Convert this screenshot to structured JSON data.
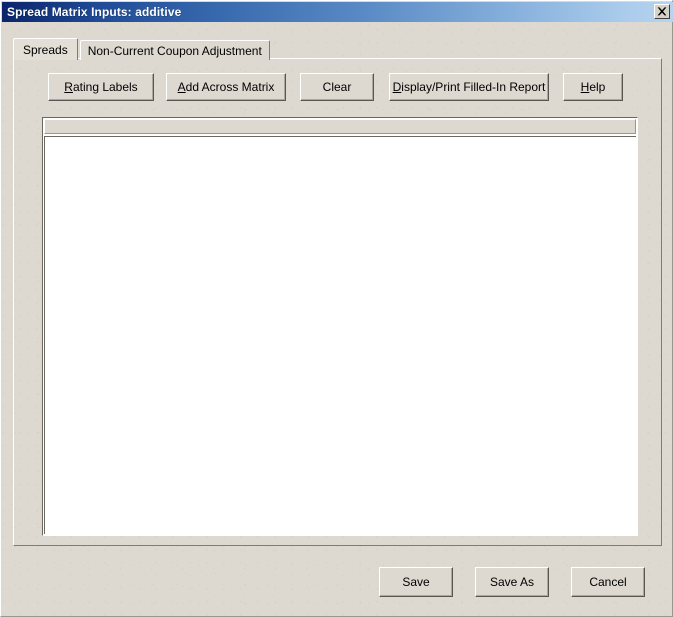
{
  "window": {
    "title": "Spread Matrix Inputs: additive",
    "close_icon": "close-icon",
    "colors": {
      "titlebar_start": "#0a246a",
      "titlebar_mid": "#5c8cc6",
      "titlebar_end": "#b6d3ef",
      "dialog_face": "#ded9d0",
      "content_background": "#ffffff",
      "text": "#000000",
      "titlebar_text": "#ffffff",
      "border_shadow": "#6b6860"
    }
  },
  "tabs": [
    {
      "label": "Spreads",
      "active": true
    },
    {
      "label": "Non-Current Coupon Adjustment",
      "active": false
    }
  ],
  "toolbar": {
    "buttons": [
      {
        "name": "rating-labels",
        "prefix": "",
        "accel": "R",
        "suffix": "ating Labels"
      },
      {
        "name": "add-across-matrix",
        "prefix": "",
        "accel": "A",
        "suffix": "dd Across Matrix"
      },
      {
        "name": "clear",
        "prefix": "Clear",
        "accel": "",
        "suffix": ""
      },
      {
        "name": "display-print",
        "prefix": "",
        "accel": "D",
        "suffix": "isplay/Print Filled-In Report"
      },
      {
        "name": "help",
        "prefix": "",
        "accel": "H",
        "suffix": "elp"
      }
    ]
  },
  "grid": {
    "header_text": "",
    "rows": [],
    "empty": true
  },
  "footer": {
    "buttons": [
      {
        "name": "save",
        "label": "Save"
      },
      {
        "name": "save-as",
        "label": "Save As"
      },
      {
        "name": "cancel",
        "label": "Cancel"
      }
    ]
  }
}
